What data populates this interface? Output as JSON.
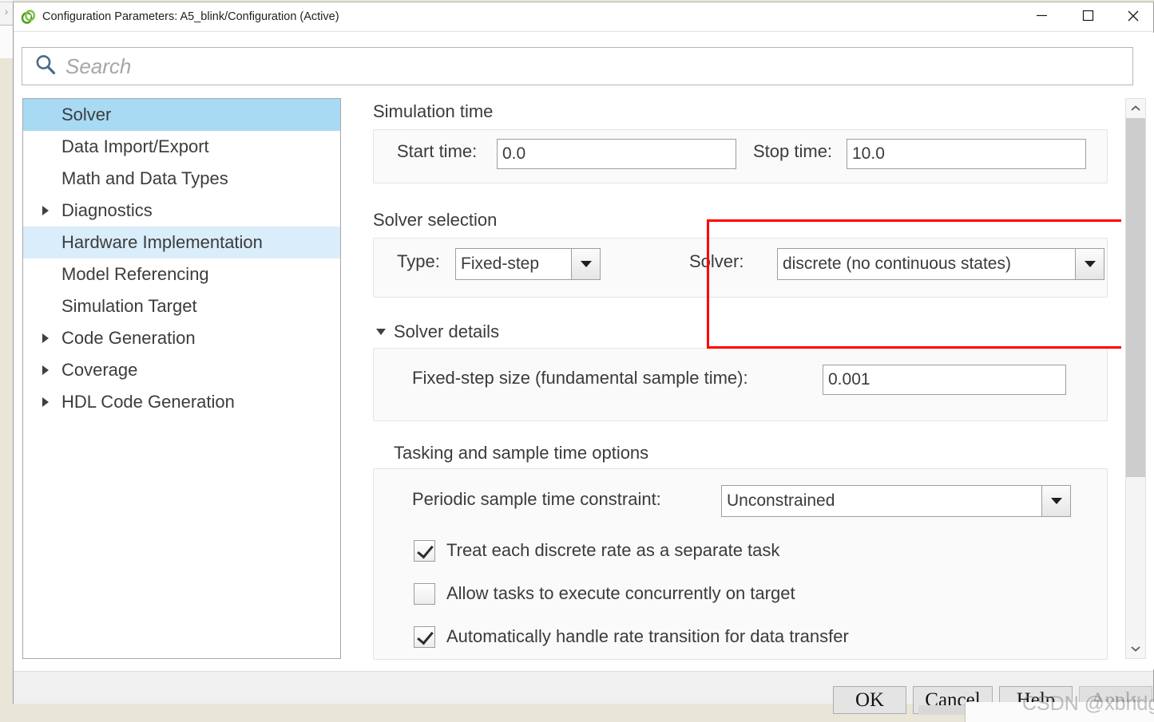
{
  "window": {
    "title": "Configuration Parameters: A5_blink/Configuration (Active)",
    "app_icon": "simulink-icon",
    "minimize_label": "—",
    "maximize_label": "□",
    "close_label": "✕"
  },
  "search": {
    "placeholder": "Search",
    "value": "",
    "icon": "search-icon"
  },
  "sidebar": {
    "items": [
      {
        "label": "Solver",
        "expandable": false,
        "state": "selected"
      },
      {
        "label": "Data Import/Export",
        "expandable": false,
        "state": "normal"
      },
      {
        "label": "Math and Data Types",
        "expandable": false,
        "state": "normal"
      },
      {
        "label": "Diagnostics",
        "expandable": true,
        "state": "normal"
      },
      {
        "label": "Hardware Implementation",
        "expandable": false,
        "state": "hover"
      },
      {
        "label": "Model Referencing",
        "expandable": false,
        "state": "normal"
      },
      {
        "label": "Simulation Target",
        "expandable": false,
        "state": "normal"
      },
      {
        "label": "Code Generation",
        "expandable": true,
        "state": "normal"
      },
      {
        "label": "Coverage",
        "expandable": true,
        "state": "normal"
      },
      {
        "label": "HDL Code Generation",
        "expandable": true,
        "state": "normal"
      }
    ]
  },
  "content": {
    "simulation_time": {
      "heading": "Simulation time",
      "start_time_label": "Start time:",
      "start_time_value": "0.0",
      "stop_time_label": "Stop time:",
      "stop_time_value": "10.0"
    },
    "solver_selection": {
      "heading": "Solver selection",
      "type_label": "Type:",
      "type_value": "Fixed-step",
      "solver_label": "Solver:",
      "solver_value": "discrete (no continuous states)"
    },
    "solver_details": {
      "heading": "Solver details",
      "fixed_step_label": "Fixed-step size (fundamental sample time):",
      "fixed_step_value": "0.001"
    },
    "tasking": {
      "heading": "Tasking and sample time options",
      "periodic_label": "Periodic sample time constraint:",
      "periodic_value": "Unconstrained",
      "checkboxes": [
        {
          "label": "Treat each discrete rate as a separate task",
          "checked": true
        },
        {
          "label": "Allow tasks to execute concurrently on target",
          "checked": false
        },
        {
          "label": "Automatically handle rate transition for data transfer",
          "checked": true
        }
      ]
    }
  },
  "scrollbar": {
    "up_arrow": "⌃",
    "down_arrow": "⌄"
  },
  "footer": {
    "ok_label": "OK",
    "cancel_label": "Cancel",
    "help_label": "Help",
    "apply_label": "Apply",
    "apply_disabled": true
  },
  "annotation": {
    "color": "#ff0000",
    "target": "solver-selection"
  },
  "watermark": {
    "text": "CSDN @xbridge"
  },
  "colors": {
    "selected_item": "#a8daf4",
    "hover_item": "#d9edfb",
    "annotation_red": "#ff0000",
    "text": "#3b3b3b",
    "panel_bg": "#fafafa"
  }
}
